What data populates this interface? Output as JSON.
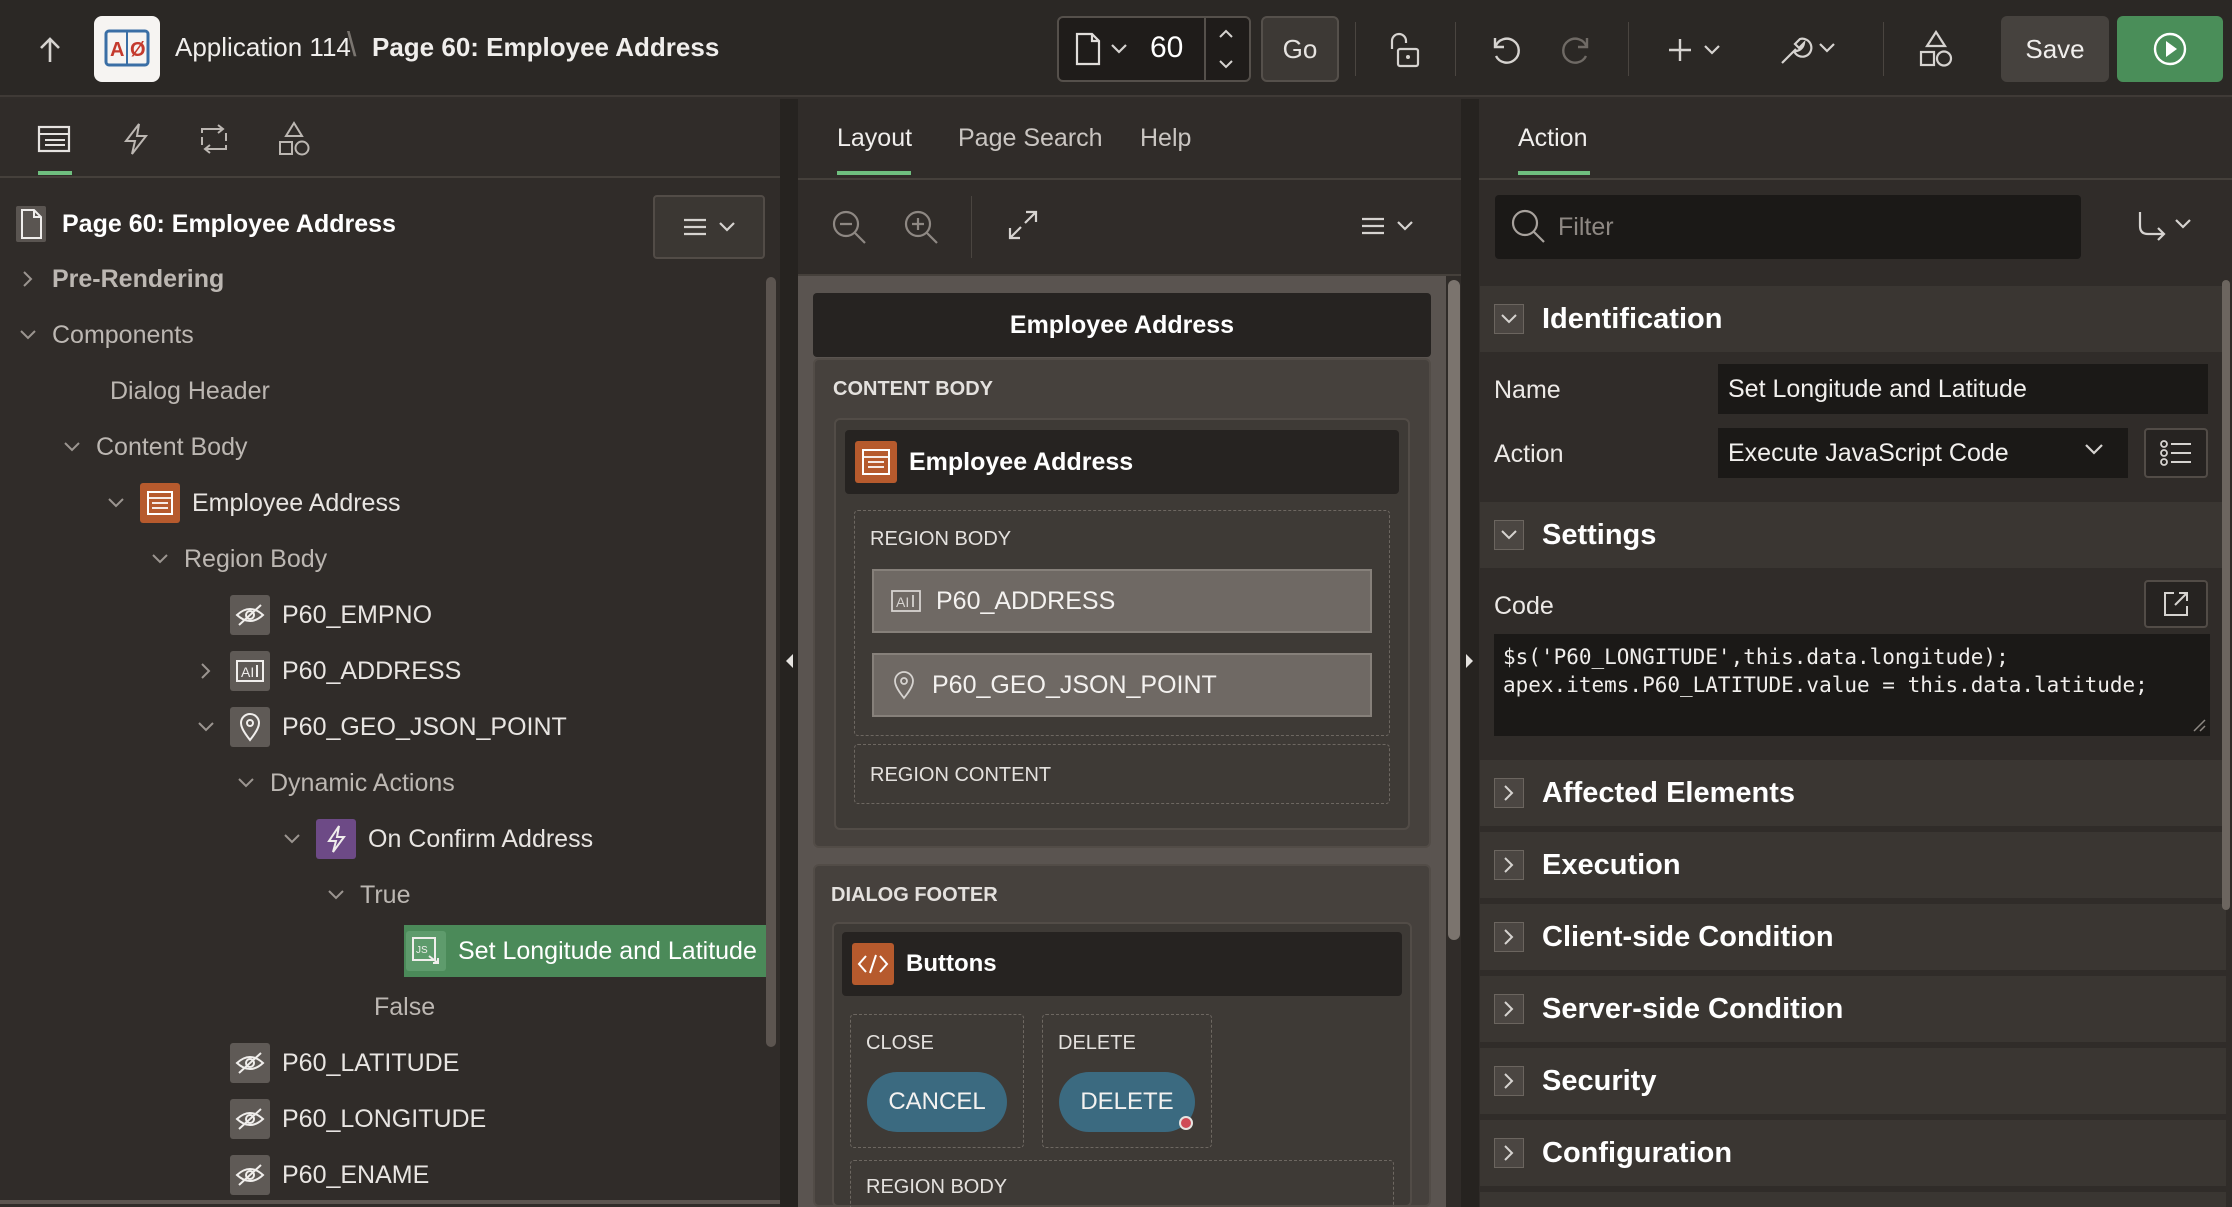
{
  "header": {
    "app_name": "Application 114",
    "page_title": "Page 60: Employee Address",
    "page_number": "60",
    "go_label": "Go",
    "save_label": "Save"
  },
  "left": {
    "tree_title": "Page 60: Employee Address",
    "tree": [
      {
        "label": "Pre-Rendering"
      },
      {
        "label": "Components"
      },
      {
        "label": "Dialog Header"
      },
      {
        "label": "Content Body"
      },
      {
        "label": "Employee Address"
      },
      {
        "label": "Region Body"
      },
      {
        "label": "P60_EMPNO"
      },
      {
        "label": "P60_ADDRESS"
      },
      {
        "label": "P60_GEO_JSON_POINT"
      },
      {
        "label": "Dynamic Actions"
      },
      {
        "label": "On Confirm Address"
      },
      {
        "label": "True"
      },
      {
        "label": "Set Longitude and Latitude"
      },
      {
        "label": "False"
      },
      {
        "label": "P60_LATITUDE"
      },
      {
        "label": "P60_LONGITUDE"
      },
      {
        "label": "P60_ENAME"
      }
    ]
  },
  "middle": {
    "tabs": [
      "Layout",
      "Page Search",
      "Help"
    ],
    "dialog_title": "Employee Address",
    "content_body_label": "CONTENT BODY",
    "region_title": "Employee Address",
    "region_body_label": "REGION BODY",
    "item_address": "P60_ADDRESS",
    "item_geo": "P60_GEO_JSON_POINT",
    "region_content_label": "REGION CONTENT",
    "dialog_footer_label": "DIALOG FOOTER",
    "buttons_title": "Buttons",
    "close_label": "CLOSE",
    "delete_label": "DELETE",
    "cancel_button": "CANCEL",
    "delete_button": "DELETE",
    "region_body_label_2": "REGION BODY"
  },
  "right": {
    "tab": "Action",
    "filter_placeholder": "Filter",
    "sections": {
      "identification": "Identification",
      "settings": "Settings",
      "affected": "Affected Elements",
      "execution": "Execution",
      "client_condition": "Client-side Condition",
      "server_condition": "Server-side Condition",
      "security": "Security",
      "configuration": "Configuration"
    },
    "name_label": "Name",
    "name_value": "Set Longitude and Latitude",
    "action_label": "Action",
    "action_value": "Execute JavaScript Code",
    "code_label": "Code",
    "code_lines": [
      "$s('P60_LONGITUDE',this.data.longitude);",
      "apex.items.P60_LATITUDE.value = this.data.latitude;"
    ]
  },
  "colors": {
    "accent_green": "#4a8e59",
    "tab_underline": "#6fbf7f",
    "pill_blue": "#3b6a80",
    "region_icon": "#b65a2d",
    "da_icon": "#6d4a86"
  }
}
